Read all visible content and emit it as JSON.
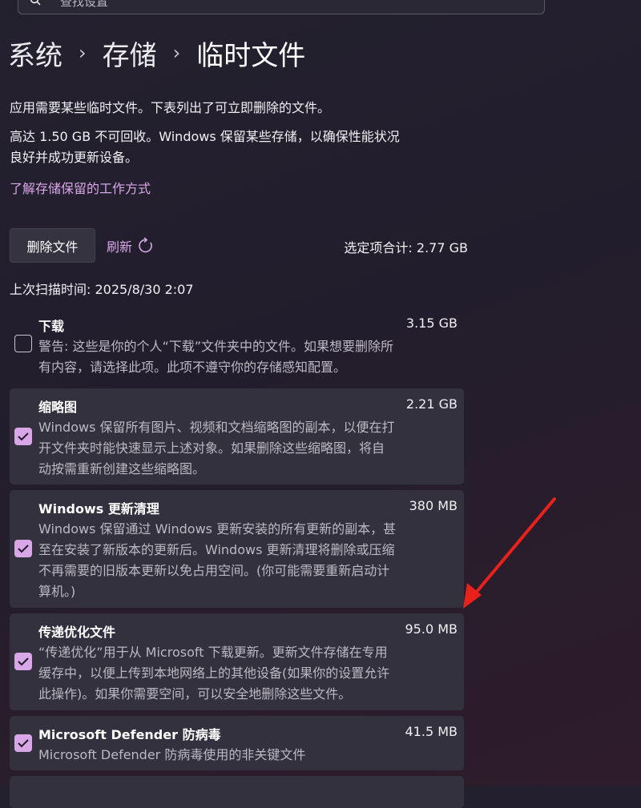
{
  "search": {
    "placeholder": "查找设置"
  },
  "breadcrumb": {
    "items": [
      "系统",
      "存储",
      "临时文件"
    ],
    "separator": "›"
  },
  "description": {
    "line1": "应用需要某些临时文件。下表列出了可立即删除的文件。",
    "line2a": "高达 1.50 GB 不可回收。Windows 保留某些存储，以确保性能状况",
    "line2b": "良好并成功更新设备。"
  },
  "learn_link": "了解存储保留的工作方式",
  "toolbar": {
    "delete_label": "删除文件",
    "refresh_label": "刷新",
    "selected_total": "选定项合计: 2.77 GB"
  },
  "last_scan": "上次扫描时间: 2025/8/30 2:07",
  "items": [
    {
      "title": "下载",
      "size": "3.15 GB",
      "checked": false,
      "lines": [
        "警告: 这些是你的个人“下载”文件夹中的文件。如果想要删除所",
        "有内容，请选择此项。此项不遵守你的存储感知配置。"
      ]
    },
    {
      "title": "缩略图",
      "size": "2.21 GB",
      "checked": true,
      "lines": [
        "Windows 保留所有图片、视频和文档缩略图的副本，以便在打",
        "开文件夹时能快速显示上述对象。如果删除这些缩略图，将自",
        "动按需重新创建这些缩略图。"
      ]
    },
    {
      "title": "Windows 更新清理",
      "size": "380 MB",
      "checked": true,
      "lines": [
        "Windows 保留通过 Windows 更新安装的所有更新的副本，甚",
        "至在安装了新版本的更新后。Windows 更新清理将删除或压缩",
        "不再需要的旧版本更新以免占用空间。(你可能需要重新启动计",
        "算机。)"
      ]
    },
    {
      "title": "传递优化文件",
      "size": "95.0 MB",
      "checked": true,
      "lines": [
        "“传递优化”用于从 Microsoft 下载更新。更新文件存储在专用",
        "缓存中，以便上传到本地网络上的其他设备(如果你的设置允许",
        "此操作)。如果你需要空间，可以安全地删除这些文件。"
      ]
    },
    {
      "title": "Microsoft Defender 防病毒",
      "size": "41.5 MB",
      "checked": true,
      "lines": [
        "Microsoft Defender 防病毒使用的非关键文件"
      ]
    }
  ],
  "colors": {
    "accent": "#d9a6e8",
    "annotation_arrow": "#e8221b",
    "card": "#33313d"
  }
}
